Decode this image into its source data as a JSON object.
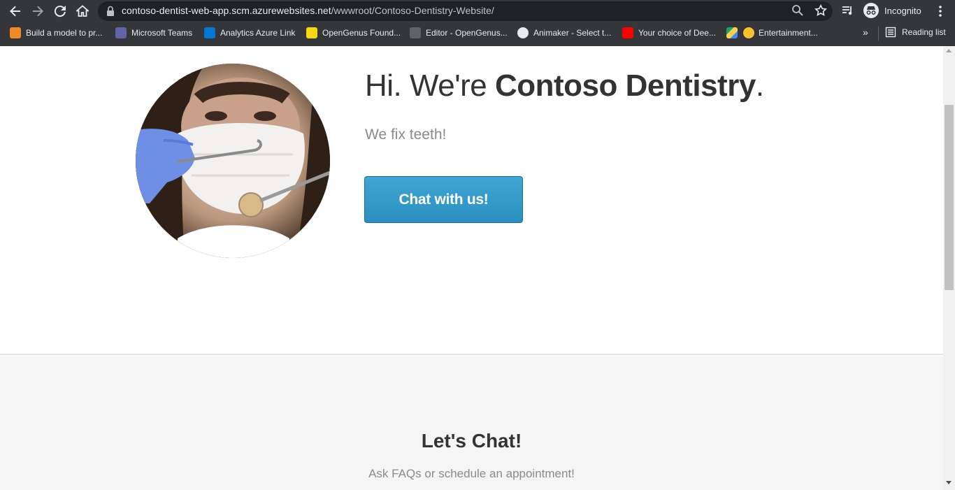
{
  "browser": {
    "url_host": "contoso-dentist-web-app.scm.azurewebsites.net",
    "url_path": "/wwwroot/Contoso-Dentistry-Website/",
    "profile_label": "Incognito",
    "more_bookmarks": "»",
    "reading_list_label": "Reading list",
    "bookmarks": [
      {
        "label": "Build a model to pr...",
        "icon": "orange-cube-icon",
        "color": "#f08a24"
      },
      {
        "label": "Microsoft Teams",
        "icon": "teams-icon",
        "color": "#6264a7"
      },
      {
        "label": "Analytics Azure Link",
        "icon": "azure-devops-icon",
        "color": "#0078d4"
      },
      {
        "label": "OpenGenus Found...",
        "icon": "opengenus-icon",
        "color": "#f5d90a"
      },
      {
        "label": "Editor - OpenGenus...",
        "icon": "editor-icon",
        "color": "#c6c6c6"
      },
      {
        "label": "Animaker - Select t...",
        "icon": "globe-icon",
        "color": "#e8eaed"
      },
      {
        "label": "Your choice of Dee...",
        "icon": "youtube-icon",
        "color": "#ff0000"
      },
      {
        "label": "",
        "icon": "google-drive-icon",
        "color": "#1fa463"
      },
      {
        "label": "Entertainment...",
        "icon": "sunglasses-emoji-icon",
        "color": "#f9c22e"
      }
    ]
  },
  "page": {
    "hero": {
      "title_prefix": "Hi. We're ",
      "title_brand": "Contoso Dentistry",
      "title_suffix": ".",
      "tagline": "We fix teeth!",
      "cta_label": "Chat with us!"
    },
    "chat": {
      "heading": "Let's Chat!",
      "subheading": "Ask FAQs or schedule an appointment!"
    }
  },
  "colors": {
    "chrome": "#35363a",
    "omnibox": "#202124",
    "accent": "#2b8ec0",
    "chat_section_bg": "#f5f5f5"
  }
}
